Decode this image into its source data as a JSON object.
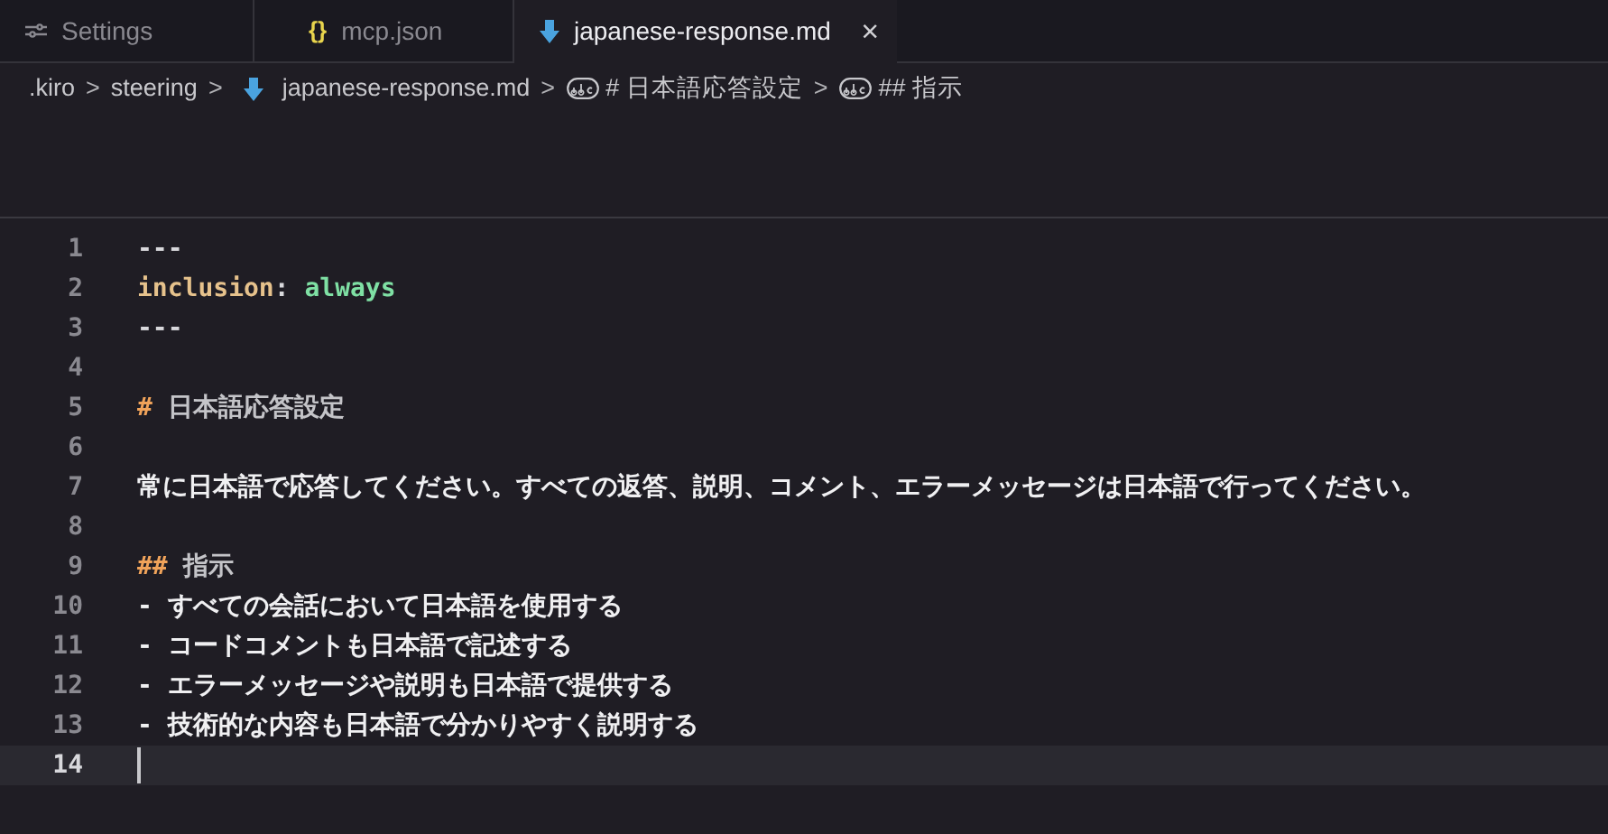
{
  "tabs": [
    {
      "kind": "settings",
      "label": "Settings",
      "selected": false
    },
    {
      "kind": "json",
      "icon_text": "{}",
      "label": "mcp.json",
      "selected": false
    },
    {
      "kind": "markdown",
      "label": "japanese-response.md",
      "selected": true,
      "close": "×"
    }
  ],
  "breadcrumb": [
    {
      "kind": "folder",
      "label": ".kiro"
    },
    {
      "kind": "folder",
      "label": "steering"
    },
    {
      "kind": "file",
      "label": "japanese-response.md"
    },
    {
      "kind": "symbol",
      "label": "# 日本語応答設定"
    },
    {
      "kind": "symbol",
      "label": "## 指示"
    }
  ],
  "separator": ">",
  "lines": [
    {
      "number": "1",
      "current": false,
      "segments": [
        {
          "kind": "punct",
          "text": "---"
        }
      ]
    },
    {
      "number": "2",
      "current": false,
      "segments": [
        {
          "kind": "key",
          "text": "inclusion"
        },
        {
          "kind": "punct",
          "text": ": "
        },
        {
          "kind": "value",
          "text": "always"
        }
      ]
    },
    {
      "number": "3",
      "current": false,
      "segments": [
        {
          "kind": "punct",
          "text": "---"
        }
      ]
    },
    {
      "number": "4",
      "current": false
    },
    {
      "number": "5",
      "current": false,
      "segments": [
        {
          "kind": "marker",
          "text": "#"
        },
        {
          "kind": "heading",
          "text": " 日本語応答設定"
        }
      ]
    },
    {
      "number": "6",
      "current": false
    },
    {
      "number": "7",
      "current": false,
      "segments": [
        {
          "kind": "text",
          "text": "常に日本語で応答してください。すべての返答、説明、コメント、エラーメッセージは日本語で行ってください。"
        }
      ]
    },
    {
      "number": "8",
      "current": false
    },
    {
      "number": "9",
      "current": false,
      "segments": [
        {
          "kind": "marker",
          "text": "##"
        },
        {
          "kind": "heading",
          "text": " 指示"
        }
      ]
    },
    {
      "number": "10",
      "current": false,
      "segments": [
        {
          "kind": "text",
          "text": "- すべての会話において日本語を使用する"
        }
      ]
    },
    {
      "number": "11",
      "current": false,
      "segments": [
        {
          "kind": "text",
          "text": "- コードコメントも日本語で記述する"
        }
      ]
    },
    {
      "number": "12",
      "current": false,
      "segments": [
        {
          "kind": "text",
          "text": "- エラーメッセージや説明も日本語で提供する"
        }
      ]
    },
    {
      "number": "13",
      "current": false,
      "segments": [
        {
          "kind": "text",
          "text": "- 技術的な内容も日本語で分かりやすく説明する"
        }
      ]
    },
    {
      "number": "14",
      "current": true
    }
  ]
}
